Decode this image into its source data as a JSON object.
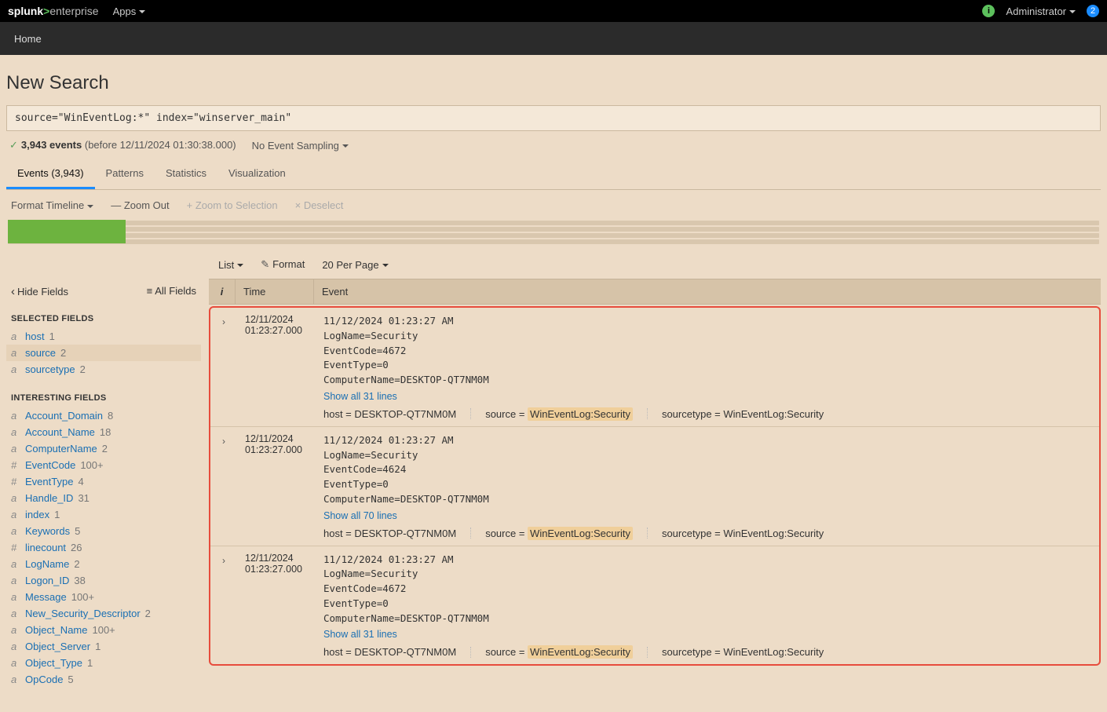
{
  "topbar": {
    "logo_pre": "splunk",
    "logo_gt": ">",
    "logo_post": "enterprise",
    "apps": "Apps",
    "admin": "Administrator",
    "badge": "2"
  },
  "subbar": {
    "home": "Home"
  },
  "page": {
    "title": "New Search"
  },
  "search": {
    "query": "source=\"WinEventLog:*\" index=\"winserver_main\""
  },
  "status": {
    "count": "3,943 events",
    "detail": "(before 12/11/2024 01:30:38.000)",
    "sampling": "No Event Sampling"
  },
  "tabs": {
    "events": "Events (3,943)",
    "patterns": "Patterns",
    "statistics": "Statistics",
    "visualization": "Visualization"
  },
  "toolbar": {
    "format": "Format Timeline",
    "zoomout": "— Zoom Out",
    "zoomsel": "+ Zoom to Selection",
    "deselect": "× Deselect"
  },
  "midbar": {
    "list": "List",
    "format": "Format",
    "perpage": "20 Per Page"
  },
  "sidetop": {
    "hide": "Hide Fields",
    "all": "All Fields"
  },
  "fields": {
    "selected_hdr": "SELECTED FIELDS",
    "interesting_hdr": "INTERESTING FIELDS",
    "selected": [
      {
        "t": "a",
        "name": "host",
        "count": "1"
      },
      {
        "t": "a",
        "name": "source",
        "count": "2"
      },
      {
        "t": "a",
        "name": "sourcetype",
        "count": "2"
      }
    ],
    "interesting": [
      {
        "t": "a",
        "name": "Account_Domain",
        "count": "8"
      },
      {
        "t": "a",
        "name": "Account_Name",
        "count": "18"
      },
      {
        "t": "a",
        "name": "ComputerName",
        "count": "2"
      },
      {
        "t": "#",
        "name": "EventCode",
        "count": "100+"
      },
      {
        "t": "#",
        "name": "EventType",
        "count": "4"
      },
      {
        "t": "a",
        "name": "Handle_ID",
        "count": "31"
      },
      {
        "t": "a",
        "name": "index",
        "count": "1"
      },
      {
        "t": "a",
        "name": "Keywords",
        "count": "5"
      },
      {
        "t": "#",
        "name": "linecount",
        "count": "26"
      },
      {
        "t": "a",
        "name": "LogName",
        "count": "2"
      },
      {
        "t": "a",
        "name": "Logon_ID",
        "count": "38"
      },
      {
        "t": "a",
        "name": "Message",
        "count": "100+"
      },
      {
        "t": "a",
        "name": "New_Security_Descriptor",
        "count": "2"
      },
      {
        "t": "a",
        "name": "Object_Name",
        "count": "100+"
      },
      {
        "t": "a",
        "name": "Object_Server",
        "count": "1"
      },
      {
        "t": "a",
        "name": "Object_Type",
        "count": "1"
      },
      {
        "t": "a",
        "name": "OpCode",
        "count": "5"
      }
    ]
  },
  "evthdr": {
    "i": "i",
    "time": "Time",
    "event": "Event"
  },
  "events": [
    {
      "date": "12/11/2024",
      "time": "01:23:27.000",
      "raw": "11/12/2024 01:23:27 AM\nLogName=Security\nEventCode=4672\nEventType=0\nComputerName=DESKTOP-QT7NM0M",
      "show": "Show all 31 lines",
      "host_k": "host =",
      "host_v": "DESKTOP-QT7NM0M",
      "src_k": "source =",
      "src_v": "WinEventLog:Security",
      "st_k": "sourcetype =",
      "st_v": "WinEventLog:Security"
    },
    {
      "date": "12/11/2024",
      "time": "01:23:27.000",
      "raw": "11/12/2024 01:23:27 AM\nLogName=Security\nEventCode=4624\nEventType=0\nComputerName=DESKTOP-QT7NM0M",
      "show": "Show all 70 lines",
      "host_k": "host =",
      "host_v": "DESKTOP-QT7NM0M",
      "src_k": "source =",
      "src_v": "WinEventLog:Security",
      "st_k": "sourcetype =",
      "st_v": "WinEventLog:Security"
    },
    {
      "date": "12/11/2024",
      "time": "01:23:27.000",
      "raw": "11/12/2024 01:23:27 AM\nLogName=Security\nEventCode=4672\nEventType=0\nComputerName=DESKTOP-QT7NM0M",
      "show": "Show all 31 lines",
      "host_k": "host =",
      "host_v": "DESKTOP-QT7NM0M",
      "src_k": "source =",
      "src_v": "WinEventLog:Security",
      "st_k": "sourcetype =",
      "st_v": "WinEventLog:Security"
    }
  ]
}
